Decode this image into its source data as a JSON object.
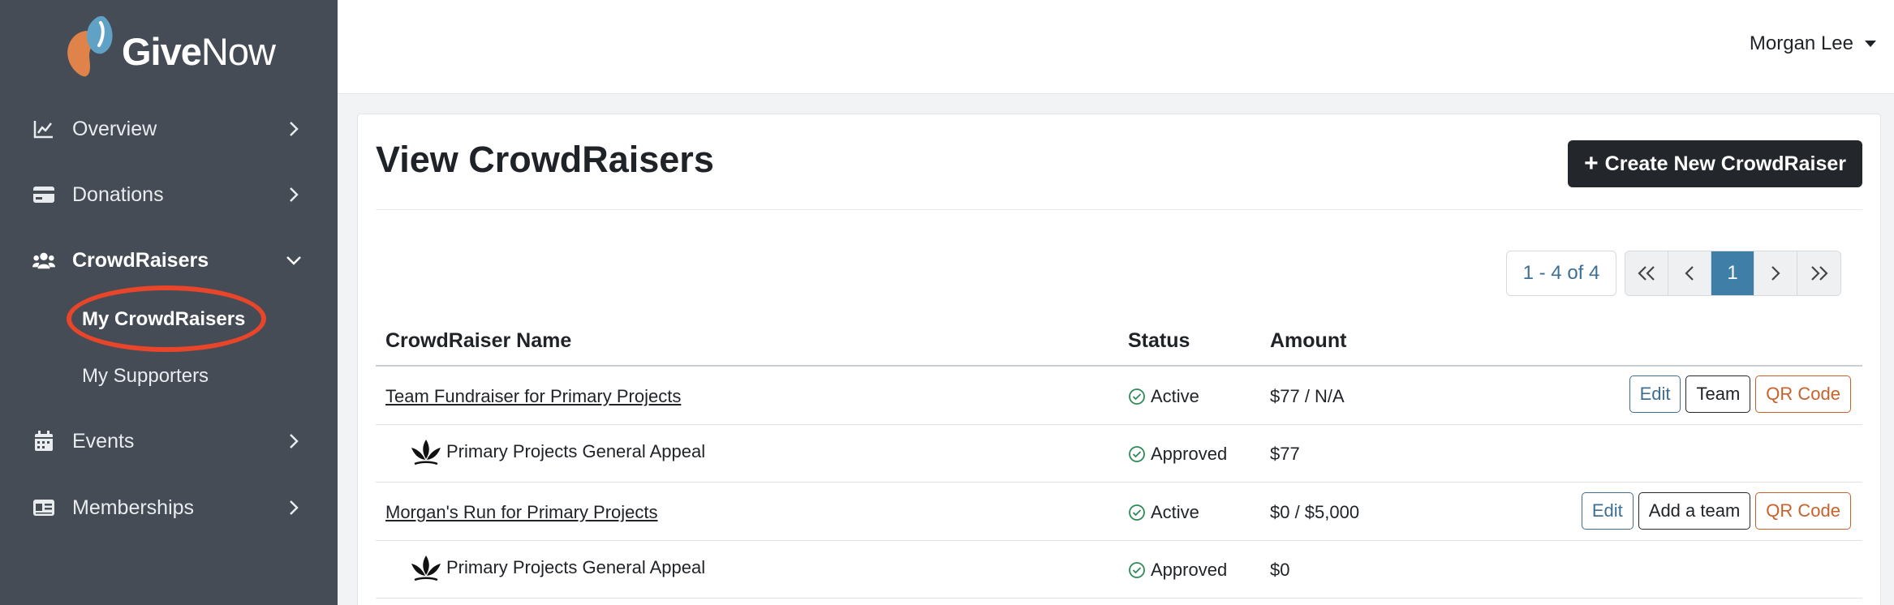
{
  "brand": {
    "name_bold": "Give",
    "name_light": "Now",
    "colors": {
      "heart_orange": "#e0834a",
      "heart_blue": "#5fa2c6"
    }
  },
  "sidebar": {
    "items": [
      {
        "label": "Overview",
        "icon": "chart-line-icon"
      },
      {
        "label": "Donations",
        "icon": "credit-card-icon"
      },
      {
        "label": "CrowdRaisers",
        "icon": "users-icon"
      },
      {
        "label": "Events",
        "icon": "calendar-icon"
      },
      {
        "label": "Memberships",
        "icon": "id-card-icon"
      }
    ],
    "sub_items": [
      {
        "label": "My CrowdRaisers"
      },
      {
        "label": "My Supporters"
      }
    ]
  },
  "topbar": {
    "user_name": "Morgan Lee"
  },
  "page": {
    "title": "View CrowdRaisers",
    "create_button": "Create New CrowdRaiser"
  },
  "pagination": {
    "info": "1 - 4 of 4",
    "current_page": "1"
  },
  "table": {
    "headers": {
      "name": "CrowdRaiser Name",
      "status": "Status",
      "amount": "Amount"
    },
    "rows": [
      {
        "name": "Team Fundraiser for Primary Projects",
        "status": "Active",
        "amount": "$77 / N/A",
        "actions": [
          "Edit",
          "Team",
          "QR Code"
        ],
        "appeal": {
          "name": "Primary Projects General Appeal",
          "status": "Approved",
          "amount": "$77"
        }
      },
      {
        "name": "Morgan's Run for Primary Projects",
        "status": "Active",
        "amount": "$0 / $5,000",
        "actions": [
          "Edit",
          "Add a team",
          "QR Code"
        ],
        "appeal": {
          "name": "Primary Projects General Appeal",
          "status": "Approved",
          "amount": "$0"
        }
      }
    ]
  }
}
